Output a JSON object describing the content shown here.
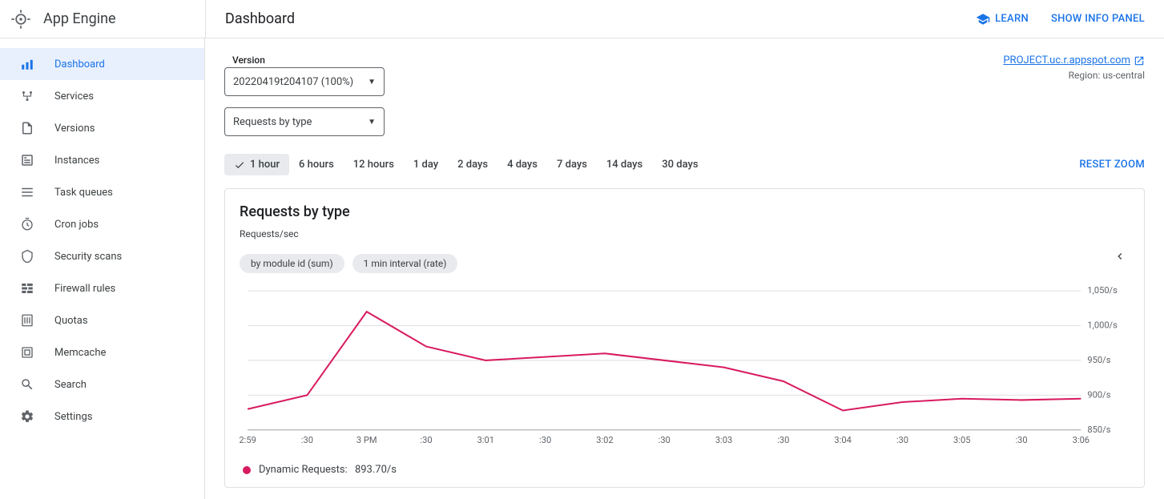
{
  "brand": {
    "name": "App Engine"
  },
  "header": {
    "title": "Dashboard",
    "learn": "LEARN",
    "show_info": "SHOW INFO PANEL"
  },
  "sidebar": {
    "items": [
      {
        "label": "Dashboard",
        "icon": "dashboard",
        "active": true
      },
      {
        "label": "Services",
        "icon": "services",
        "active": false
      },
      {
        "label": "Versions",
        "icon": "versions",
        "active": false
      },
      {
        "label": "Instances",
        "icon": "instances",
        "active": false
      },
      {
        "label": "Task queues",
        "icon": "taskqueues",
        "active": false
      },
      {
        "label": "Cron jobs",
        "icon": "cron",
        "active": false
      },
      {
        "label": "Security scans",
        "icon": "security",
        "active": false
      },
      {
        "label": "Firewall rules",
        "icon": "firewall",
        "active": false
      },
      {
        "label": "Quotas",
        "icon": "quotas",
        "active": false
      },
      {
        "label": "Memcache",
        "icon": "memcache",
        "active": false
      },
      {
        "label": "Search",
        "icon": "search",
        "active": false
      },
      {
        "label": "Settings",
        "icon": "settings",
        "active": false
      }
    ]
  },
  "main": {
    "version_label": "Version",
    "version_value": "20220419t204107 (100%)",
    "metric_value": "Requests by type",
    "project_link": "PROJECT.uc.r.appspot.com",
    "region": "Region: us-central",
    "reset_zoom": "RESET ZOOM",
    "ranges": [
      "1 hour",
      "6 hours",
      "12 hours",
      "1 day",
      "2 days",
      "4 days",
      "7 days",
      "14 days",
      "30 days"
    ],
    "active_range": 0
  },
  "chart": {
    "title": "Requests by type",
    "subtitle": "Requests/sec",
    "chips": [
      "by module id (sum)",
      "1 min interval (rate)"
    ],
    "legend_label": "Dynamic Requests:",
    "legend_value": "893.70/s"
  },
  "chart_data": {
    "type": "line",
    "title": "Requests by type",
    "xlabel": "",
    "ylabel": "Requests/sec",
    "ylim": [
      850,
      1050
    ],
    "y_ticks": [
      "850/s",
      "900/s",
      "950/s",
      "1,000/s",
      "1,050/s"
    ],
    "x_ticks": [
      "2:59",
      ":30",
      "3 PM",
      ":30",
      "3:01",
      ":30",
      "3:02",
      ":30",
      "3:03",
      ":30",
      "3:04",
      ":30",
      "3:05",
      ":30",
      "3:06"
    ],
    "series": [
      {
        "name": "Dynamic Requests",
        "color": "#d81b60",
        "values": [
          880,
          900,
          1020,
          970,
          950,
          955,
          960,
          950,
          940,
          920,
          878,
          890,
          895,
          893,
          895
        ]
      }
    ]
  }
}
